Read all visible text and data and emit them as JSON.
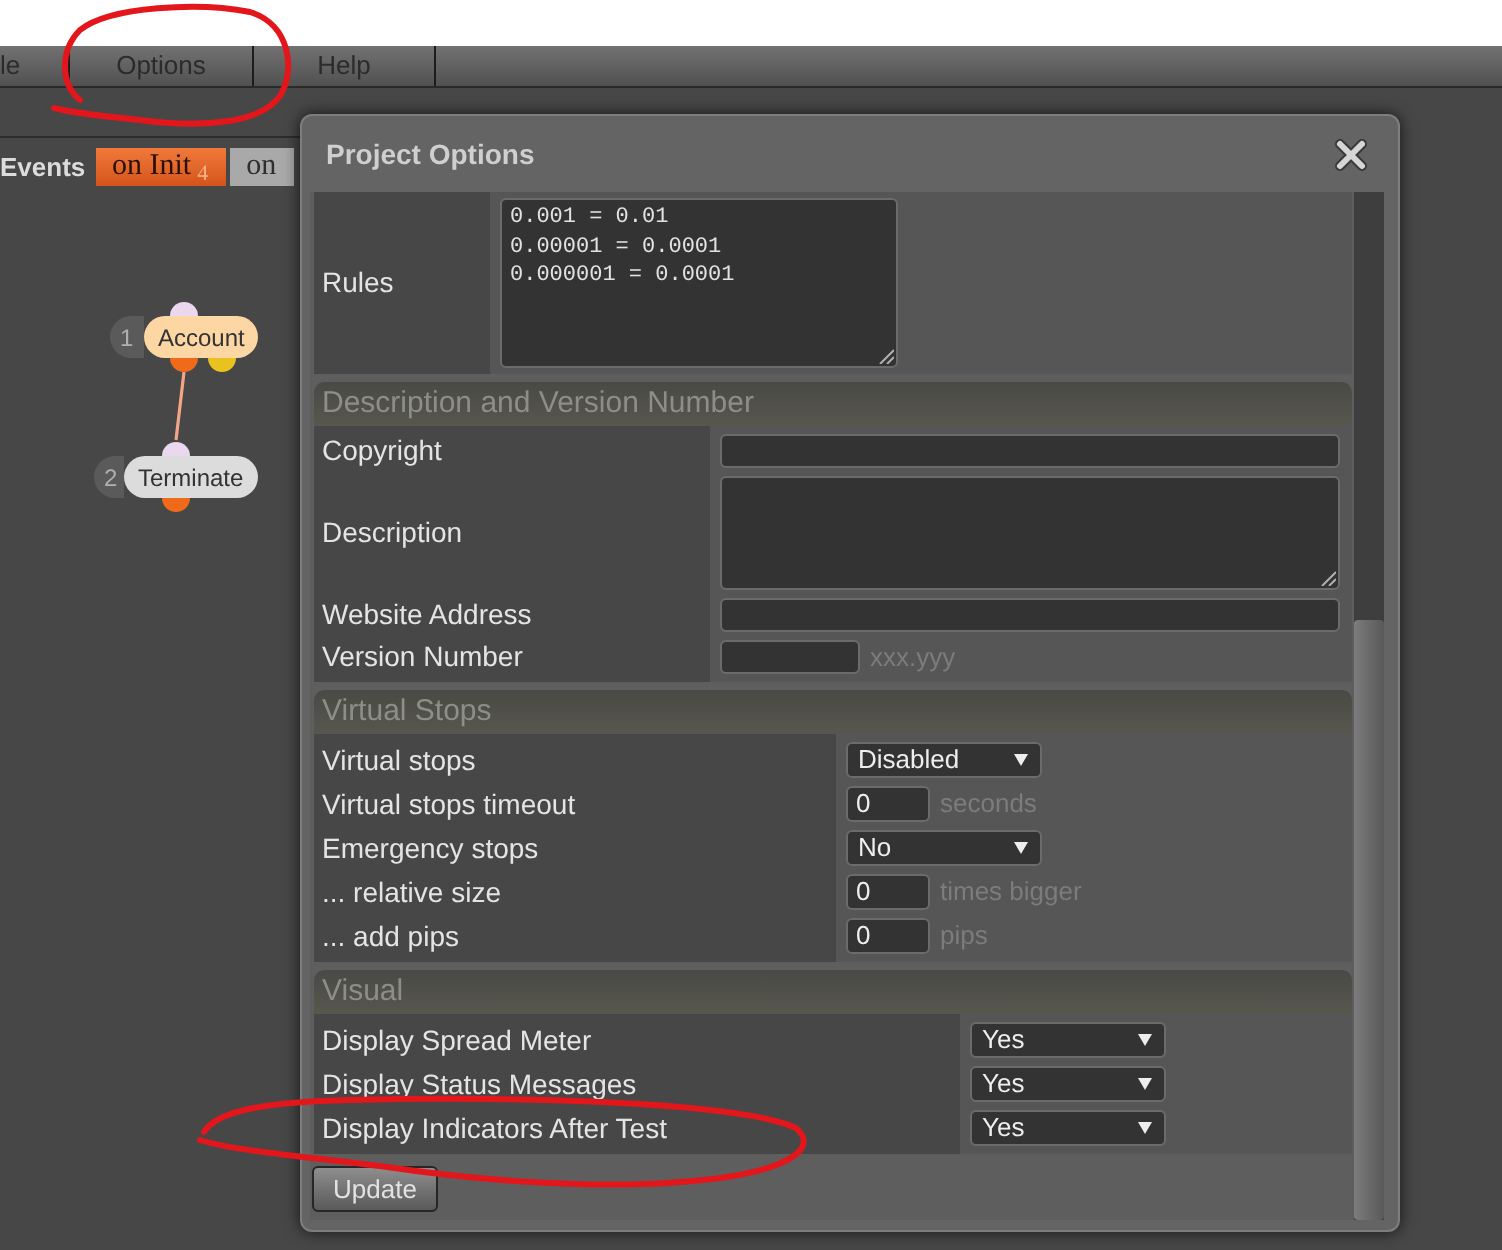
{
  "menu_bar": {
    "items": [
      {
        "label": "le"
      },
      {
        "label": "Options"
      },
      {
        "label": "Help"
      }
    ]
  },
  "events": {
    "label": "Events",
    "tabs": [
      {
        "label": "on Init",
        "count": "4",
        "selected": true
      },
      {
        "label": "on",
        "selected": false
      }
    ]
  },
  "flow": {
    "nodes": [
      {
        "number": "1",
        "label": "Account",
        "color": "#fcd7a4"
      },
      {
        "number": "2",
        "label": "Terminate",
        "color": "#dcdcdc"
      }
    ]
  },
  "dialog": {
    "title": "Project Options",
    "sections": [
      {
        "rows": [
          {
            "kind": "textarea",
            "label": "Rules",
            "value": "0.001 = 0.01\n0.00001 = 0.0001\n0.000001 = 0.0001"
          }
        ]
      },
      {
        "title": "Description and Version Number",
        "rows": [
          {
            "kind": "text",
            "label": "Copyright"
          },
          {
            "kind": "textarea",
            "label": "Description"
          },
          {
            "kind": "text",
            "label": "Website Address"
          },
          {
            "kind": "text",
            "label": "Version Number",
            "hint": "xxx.yyy"
          }
        ]
      },
      {
        "title": "Virtual Stops",
        "rows": [
          {
            "kind": "select",
            "label": "Virtual stops",
            "value": "Disabled"
          },
          {
            "kind": "number",
            "label": "Virtual stops timeout",
            "value": "0",
            "unit": "seconds"
          },
          {
            "kind": "select",
            "label": "Emergency stops",
            "value": "No"
          },
          {
            "kind": "number",
            "label": "... relative size",
            "value": "0",
            "unit": "times bigger"
          },
          {
            "kind": "number",
            "label": "... add pips",
            "value": "0",
            "unit": "pips"
          }
        ]
      },
      {
        "title": "Visual",
        "rows": [
          {
            "kind": "select",
            "label": "Display Spread Meter",
            "value": "Yes"
          },
          {
            "kind": "select",
            "label": "Display Status Messages",
            "value": "Yes"
          },
          {
            "kind": "select",
            "label": "Display Indicators After Test",
            "value": "Yes"
          }
        ]
      }
    ],
    "buttons": [
      {
        "label": "Update"
      }
    ]
  },
  "annotations": [
    {
      "kind": "hand-drawn-circle"
    },
    {
      "kind": "hand-drawn-circle"
    }
  ]
}
